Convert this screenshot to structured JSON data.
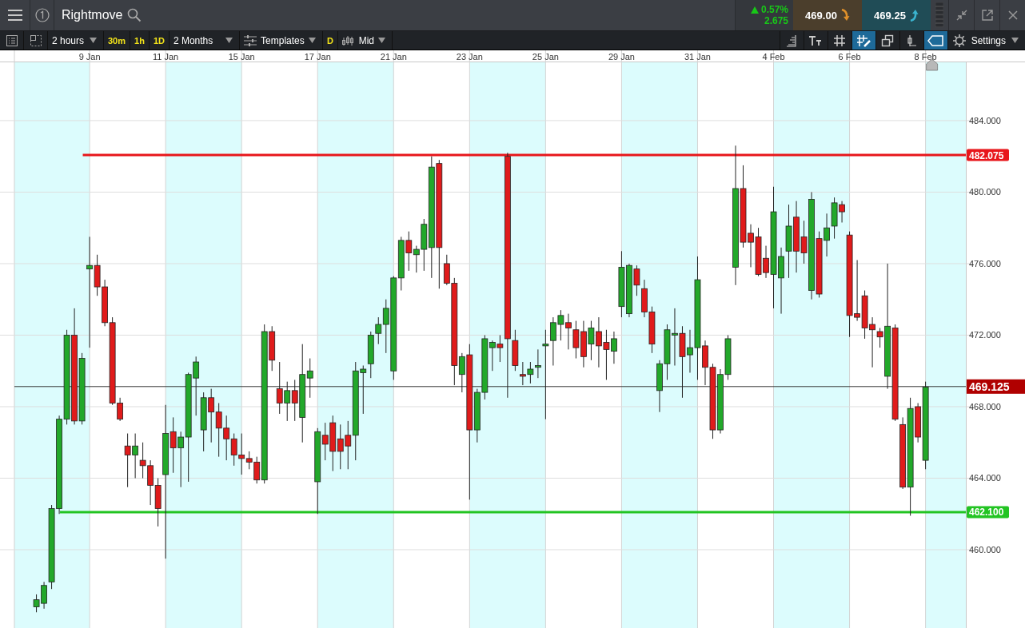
{
  "header": {
    "title": "Rightmove",
    "change": {
      "percent": "0.57%",
      "points": "2.675"
    },
    "sell": {
      "price": "469.00"
    },
    "buy": {
      "price": "469.25"
    }
  },
  "toolbar": {
    "left": [
      {
        "kind": "select",
        "label": "2 hours"
      },
      {
        "kind": "chip",
        "label": "30m"
      },
      {
        "kind": "chip",
        "label": "1h"
      },
      {
        "kind": "chip",
        "label": "1D"
      },
      {
        "kind": "select",
        "label": "2 Months"
      },
      {
        "kind": "templates",
        "label": "Templates"
      },
      {
        "kind": "chip",
        "label": "D"
      },
      {
        "kind": "price-type",
        "label": "Mid"
      }
    ],
    "right": [
      {
        "kind": "scale",
        "selected": false
      },
      {
        "kind": "text",
        "selected": false
      },
      {
        "kind": "grid",
        "selected": false
      },
      {
        "kind": "draw",
        "selected": true
      },
      {
        "kind": "layers",
        "selected": false
      },
      {
        "kind": "candle",
        "selected": false
      },
      {
        "kind": "tag",
        "selected": true
      }
    ],
    "settings": "Settings"
  },
  "chart": {
    "chart_data": {
      "type": "candlestick",
      "grid": true,
      "ylim": [
        455.62,
        487.26
      ],
      "categories": [
        null,
        null,
        null,
        null,
        null,
        null,
        null,
        "9 Jan",
        null,
        null,
        null,
        null,
        null,
        null,
        null,
        null,
        null,
        "11 Jan",
        null,
        null,
        null,
        null,
        null,
        null,
        null,
        null,
        null,
        "15 Jan",
        null,
        null,
        null,
        null,
        null,
        null,
        null,
        null,
        null,
        "17 Jan",
        null,
        null,
        null,
        null,
        null,
        null,
        null,
        null,
        null,
        "21 Jan",
        null,
        null,
        null,
        null,
        null,
        null,
        null,
        null,
        null,
        "23 Jan",
        null,
        null,
        null,
        null,
        null,
        null,
        null,
        null,
        null,
        "25 Jan",
        null,
        null,
        null,
        null,
        null,
        null,
        null,
        null,
        null,
        "29 Jan",
        null,
        null,
        null,
        null,
        null,
        null,
        null,
        null,
        null,
        "31 Jan",
        null,
        null,
        null,
        null,
        null,
        null,
        null,
        null,
        null,
        "4 Feb",
        null,
        null,
        null,
        null,
        null,
        null,
        null,
        null,
        null,
        "6 Feb",
        null,
        null,
        null,
        null,
        null,
        null,
        null,
        null,
        null,
        "8 Feb"
      ],
      "yticks": [
        {
          "value": 460,
          "label": "460.000"
        },
        {
          "value": 464,
          "label": "464.000"
        },
        {
          "value": 468,
          "label": "468.000"
        },
        {
          "value": 472,
          "label": "472.000"
        },
        {
          "value": 476,
          "label": "476.000"
        },
        {
          "value": 480,
          "label": "480.000"
        },
        {
          "value": 484,
          "label": "484.000"
        }
      ],
      "ohlc": [
        [
          456.8,
          457.5,
          456.5,
          457.2
        ],
        [
          457.0,
          458.2,
          456.7,
          458.0
        ],
        [
          458.2,
          462.5,
          457.8,
          462.3
        ],
        [
          462.3,
          467.5,
          462.0,
          467.3
        ],
        [
          467.3,
          472.3,
          467.0,
          472.0
        ],
        [
          472.0,
          473.5,
          467.0,
          467.2
        ],
        [
          467.2,
          471.0,
          467.0,
          470.7
        ],
        [
          475.7,
          477.5,
          471.3,
          475.9
        ],
        [
          475.9,
          476.5,
          474.2,
          474.7
        ],
        [
          474.7,
          475.1,
          472.5,
          472.7
        ],
        [
          472.7,
          473.0,
          468.1,
          468.2
        ],
        [
          468.2,
          468.5,
          467.2,
          467.3
        ],
        [
          465.8,
          466.5,
          463.5,
          465.3
        ],
        [
          465.3,
          466.5,
          464.0,
          465.8
        ],
        [
          465.0,
          466.0,
          464.0,
          464.7
        ],
        [
          464.7,
          465.0,
          462.5,
          463.6
        ],
        [
          463.6,
          464.0,
          461.3,
          462.3
        ],
        [
          464.2,
          468.1,
          459.5,
          466.5
        ],
        [
          466.6,
          467.4,
          464.3,
          465.7
        ],
        [
          465.7,
          466.6,
          463.5,
          466.3
        ],
        [
          466.3,
          469.9,
          463.8,
          469.8
        ],
        [
          469.6,
          470.8,
          467.5,
          470.5
        ],
        [
          466.7,
          468.8,
          465.5,
          468.5
        ],
        [
          468.5,
          469.0,
          466.0,
          467.7
        ],
        [
          467.7,
          468.2,
          465.2,
          466.8
        ],
        [
          466.8,
          467.5,
          465.0,
          466.2
        ],
        [
          466.2,
          466.5,
          464.7,
          465.3
        ],
        [
          465.3,
          466.5,
          464.2,
          465.1
        ],
        [
          465.1,
          465.5,
          464.5,
          464.9
        ],
        [
          464.9,
          465.2,
          463.7,
          463.9
        ],
        [
          463.9,
          472.6,
          463.7,
          472.2
        ],
        [
          472.2,
          472.5,
          470.0,
          470.6
        ],
        [
          469.0,
          470.5,
          467.6,
          468.2
        ],
        [
          468.2,
          469.4,
          467.2,
          468.9
        ],
        [
          468.9,
          469.5,
          467.2,
          468.2
        ],
        [
          467.4,
          471.5,
          466.0,
          469.8
        ],
        [
          469.6,
          470.7,
          468.5,
          470.0
        ],
        [
          463.8,
          466.8,
          462.0,
          466.6
        ],
        [
          466.4,
          467.1,
          465.0,
          465.9
        ],
        [
          467.1,
          467.5,
          464.4,
          465.5
        ],
        [
          466.2,
          467.0,
          464.5,
          465.5
        ],
        [
          466.4,
          467.2,
          464.5,
          465.8
        ],
        [
          466.4,
          470.5,
          465.0,
          470.0
        ],
        [
          469.9,
          470.3,
          467.6,
          470.1
        ],
        [
          470.4,
          472.2,
          469.6,
          472.0
        ],
        [
          472.1,
          473.0,
          471.5,
          472.6
        ],
        [
          472.6,
          474.0,
          471.0,
          473.5
        ],
        [
          470.0,
          475.3,
          469.5,
          475.2
        ],
        [
          475.2,
          477.5,
          474.5,
          477.3
        ],
        [
          477.3,
          477.8,
          475.6,
          476.6
        ],
        [
          476.5,
          477.0,
          475.5,
          476.8
        ],
        [
          476.8,
          478.5,
          475.6,
          478.2
        ],
        [
          476.9,
          482.0,
          475.2,
          481.4
        ],
        [
          481.6,
          481.8,
          474.6,
          476.9
        ],
        [
          476.0,
          476.5,
          474.8,
          474.9
        ],
        [
          474.9,
          475.2,
          469.2,
          470.3
        ],
        [
          469.8,
          471.0,
          468.8,
          470.8
        ],
        [
          470.9,
          471.5,
          462.8,
          466.7
        ],
        [
          466.7,
          469.0,
          466.0,
          468.8
        ],
        [
          468.8,
          472.0,
          468.4,
          471.8
        ],
        [
          471.3,
          471.7,
          470.0,
          471.6
        ],
        [
          471.5,
          472.0,
          470.5,
          471.3
        ],
        [
          482.0,
          482.2,
          468.5,
          471.8
        ],
        [
          471.7,
          472.3,
          470.0,
          470.3
        ],
        [
          469.8,
          470.5,
          469.2,
          469.7
        ],
        [
          469.8,
          470.5,
          469.3,
          470.1
        ],
        [
          470.2,
          471.2,
          469.6,
          470.3
        ],
        [
          471.4,
          472.3,
          467.3,
          471.5
        ],
        [
          471.7,
          473.0,
          470.3,
          472.7
        ],
        [
          472.6,
          473.4,
          471.7,
          473.1
        ],
        [
          472.7,
          473.2,
          471.2,
          472.4
        ],
        [
          472.3,
          472.8,
          470.7,
          471.3
        ],
        [
          472.2,
          472.8,
          470.2,
          470.8
        ],
        [
          471.5,
          472.8,
          470.6,
          472.4
        ],
        [
          472.2,
          473.0,
          470.2,
          471.4
        ],
        [
          471.6,
          472.3,
          469.5,
          471.2
        ],
        [
          471.1,
          472.2,
          470.4,
          471.8
        ],
        [
          473.6,
          476.7,
          473.0,
          475.8
        ],
        [
          473.2,
          476.0,
          473.0,
          475.9
        ],
        [
          475.7,
          475.9,
          474.2,
          474.8
        ],
        [
          474.6,
          475.1,
          473.0,
          473.3
        ],
        [
          473.3,
          473.6,
          471.0,
          471.5
        ],
        [
          468.9,
          470.6,
          467.7,
          470.4
        ],
        [
          470.4,
          472.6,
          469.5,
          472.3
        ],
        [
          472.0,
          473.5,
          470.3,
          472.1
        ],
        [
          472.1,
          472.5,
          468.5,
          470.8
        ],
        [
          470.9,
          472.3,
          469.9,
          471.3
        ],
        [
          471.3,
          476.4,
          469.5,
          475.1
        ],
        [
          471.4,
          471.7,
          469.2,
          470.2
        ],
        [
          470.2,
          470.4,
          466.2,
          466.7
        ],
        [
          466.7,
          470.1,
          466.5,
          469.8
        ],
        [
          469.8,
          472.0,
          469.5,
          471.8
        ],
        [
          475.8,
          482.6,
          474.8,
          480.2
        ],
        [
          480.2,
          481.5,
          476.9,
          477.2
        ],
        [
          477.7,
          478.2,
          475.8,
          477.2
        ],
        [
          477.5,
          478.0,
          475.3,
          475.4
        ],
        [
          476.3,
          477.0,
          475.2,
          475.5
        ],
        [
          475.4,
          480.3,
          473.5,
          478.9
        ],
        [
          475.2,
          476.9,
          473.2,
          476.4
        ],
        [
          476.7,
          479.3,
          475.2,
          478.1
        ],
        [
          478.6,
          479.5,
          475.5,
          476.7
        ],
        [
          477.5,
          478.4,
          476.0,
          476.6
        ],
        [
          474.5,
          480.0,
          474.0,
          479.6
        ],
        [
          477.4,
          477.8,
          474.1,
          474.3
        ],
        [
          477.3,
          478.8,
          476.4,
          478.0
        ],
        [
          478.1,
          479.7,
          477.4,
          479.4
        ],
        [
          479.3,
          479.5,
          478.3,
          478.9
        ],
        [
          477.6,
          477.8,
          471.9,
          473.1
        ],
        [
          473.2,
          476.2,
          472.8,
          473.0
        ],
        [
          474.2,
          474.5,
          471.8,
          472.4
        ],
        [
          472.6,
          473.0,
          470.2,
          472.3
        ],
        [
          472.2,
          472.4,
          471.3,
          471.9
        ],
        [
          469.7,
          476.0,
          469.0,
          472.5
        ],
        [
          472.4,
          472.6,
          467.2,
          467.3
        ],
        [
          467.0,
          467.4,
          463.4,
          463.5
        ],
        [
          463.5,
          468.5,
          461.9,
          467.9
        ],
        [
          468.0,
          468.2,
          466.0,
          466.3
        ],
        [
          465.0,
          469.4,
          464.5,
          469.1
        ]
      ],
      "ref_lines": [
        {
          "axis": "y",
          "value": 482.075,
          "label": "482.075",
          "color": "#e8161b"
        },
        {
          "axis": "y",
          "value": 462.1,
          "label": "462.100",
          "color": "#22c422"
        },
        {
          "axis": "y",
          "value": 469.125,
          "label": "469.125",
          "color": "#333333"
        }
      ]
    }
  }
}
